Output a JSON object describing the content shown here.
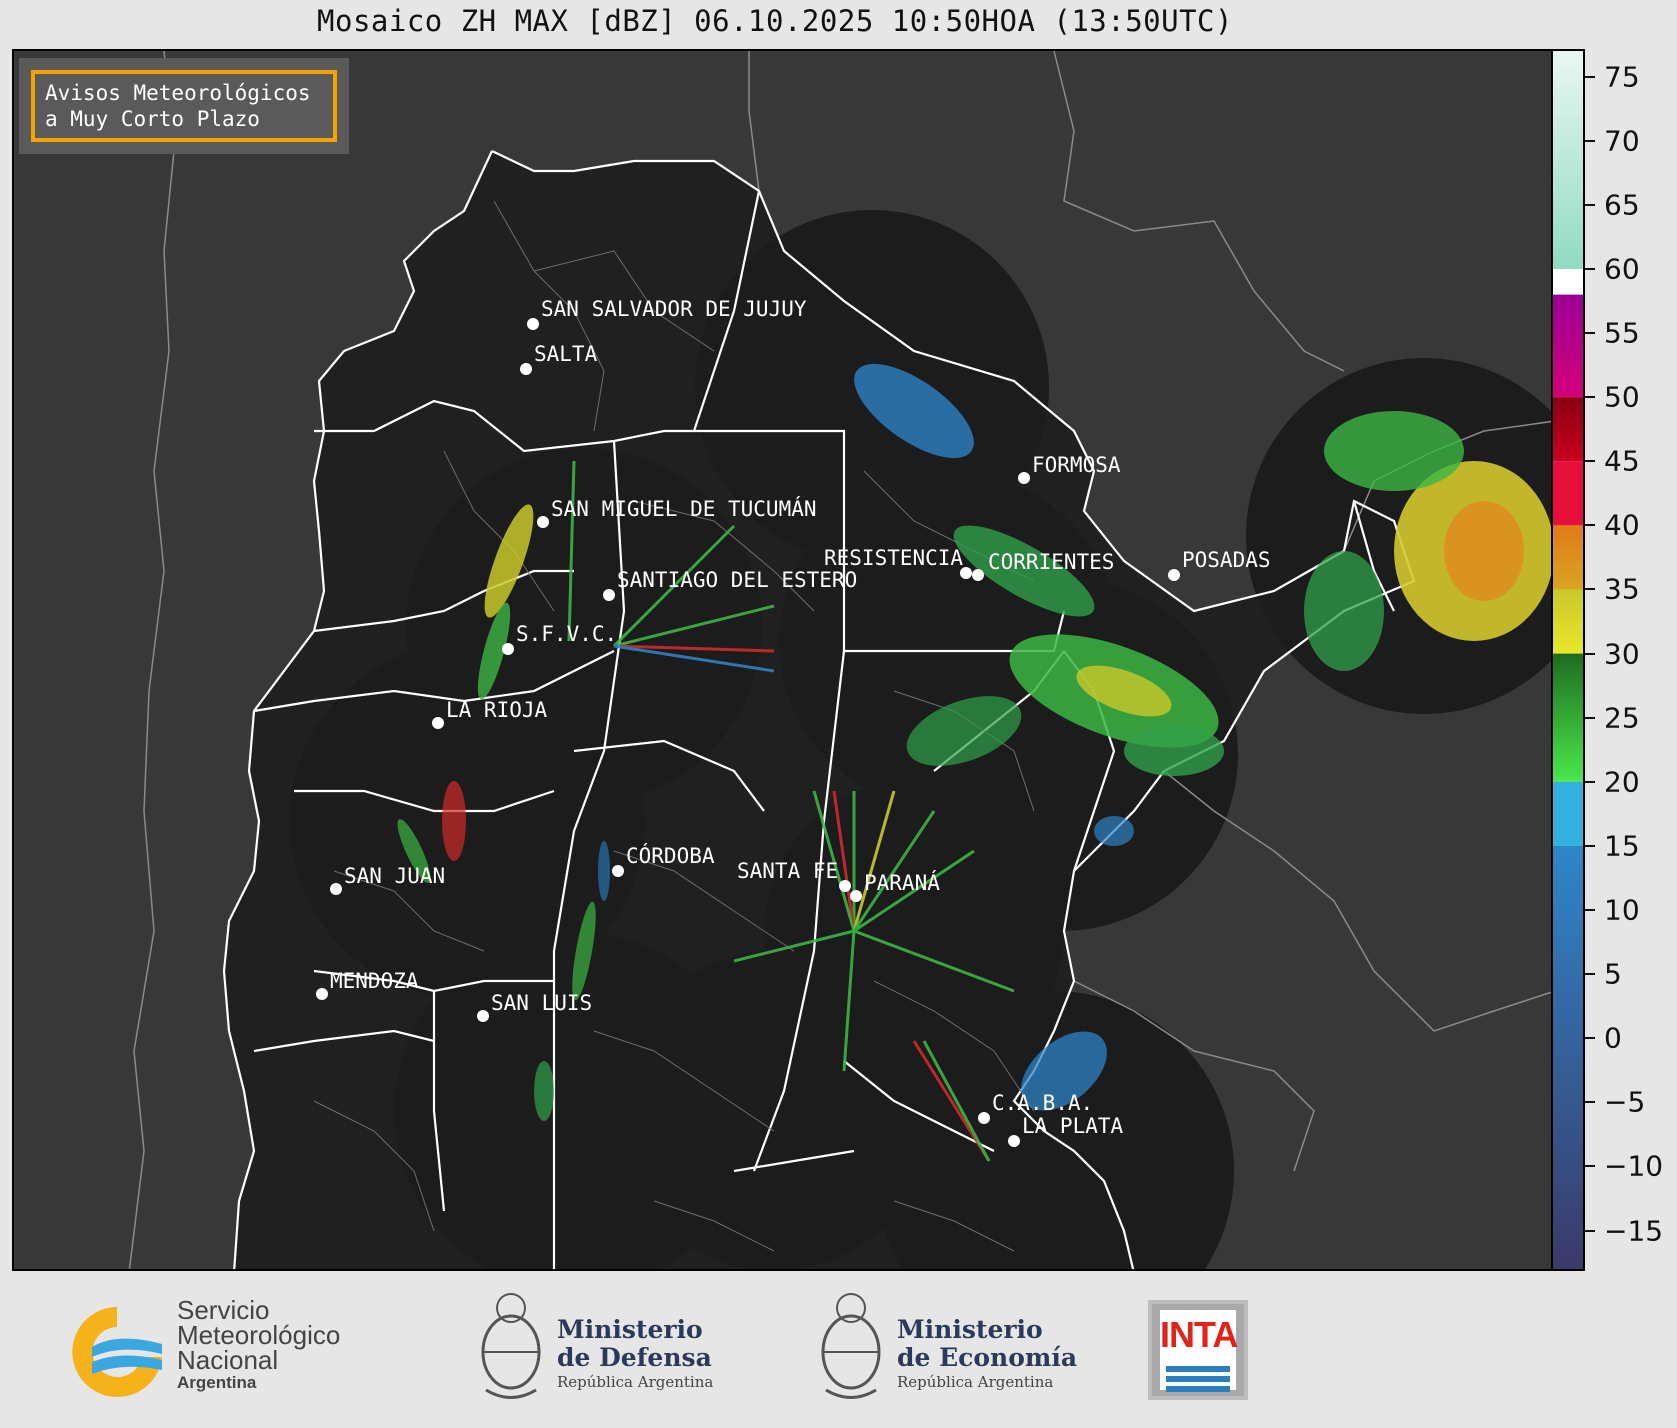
{
  "title": "Mosaico ZH MAX [dBZ] 06.10.2025 10:50HOA (13:50UTC)",
  "alert_box": {
    "line1": "Avisos Meteorológicos",
    "line2": "a Muy Corto Plazo",
    "border_color": "#f5a300"
  },
  "colorbar": {
    "unit": "dBZ",
    "min": -18,
    "max": 77,
    "ticks": [
      "75",
      "70",
      "65",
      "60",
      "55",
      "50",
      "45",
      "40",
      "35",
      "30",
      "25",
      "20",
      "15",
      "10",
      "5",
      "0",
      "−5",
      "−10",
      "−15"
    ],
    "tick_values": [
      75,
      70,
      65,
      60,
      55,
      50,
      45,
      40,
      35,
      30,
      25,
      20,
      15,
      10,
      5,
      0,
      -5,
      -10,
      -15
    ]
  },
  "cities": [
    {
      "name": "SAN SALVADOR DE JUJUY"
    },
    {
      "name": "SALTA"
    },
    {
      "name": "SAN MIGUEL DE TUCUMÁN"
    },
    {
      "name": "SANTIAGO DEL ESTERO"
    },
    {
      "name": "S.F.V.C."
    },
    {
      "name": "LA RIOJA"
    },
    {
      "name": "SAN JUAN"
    },
    {
      "name": "MENDOZA"
    },
    {
      "name": "SAN LUIS"
    },
    {
      "name": "CÓRDOBA"
    },
    {
      "name": "SANTA FE"
    },
    {
      "name": "PARANÁ"
    },
    {
      "name": "RESISTENCIA"
    },
    {
      "name": "CORRIENTES"
    },
    {
      "name": "FORMOSA"
    },
    {
      "name": "POSADAS"
    },
    {
      "name": "C.A.B.A."
    },
    {
      "name": "LA PLATA"
    }
  ],
  "logos": {
    "smn": {
      "line1": "Servicio",
      "line2": "Meteorológico",
      "line3": "Nacional",
      "line4": "Argentina"
    },
    "defensa": {
      "line1": "Ministerio",
      "line2": "de Defensa",
      "line3": "República Argentina"
    },
    "economia": {
      "line1": "Ministerio",
      "line2": "de Economía",
      "line3": "República Argentina"
    },
    "inta": {
      "text": "INTA"
    }
  }
}
